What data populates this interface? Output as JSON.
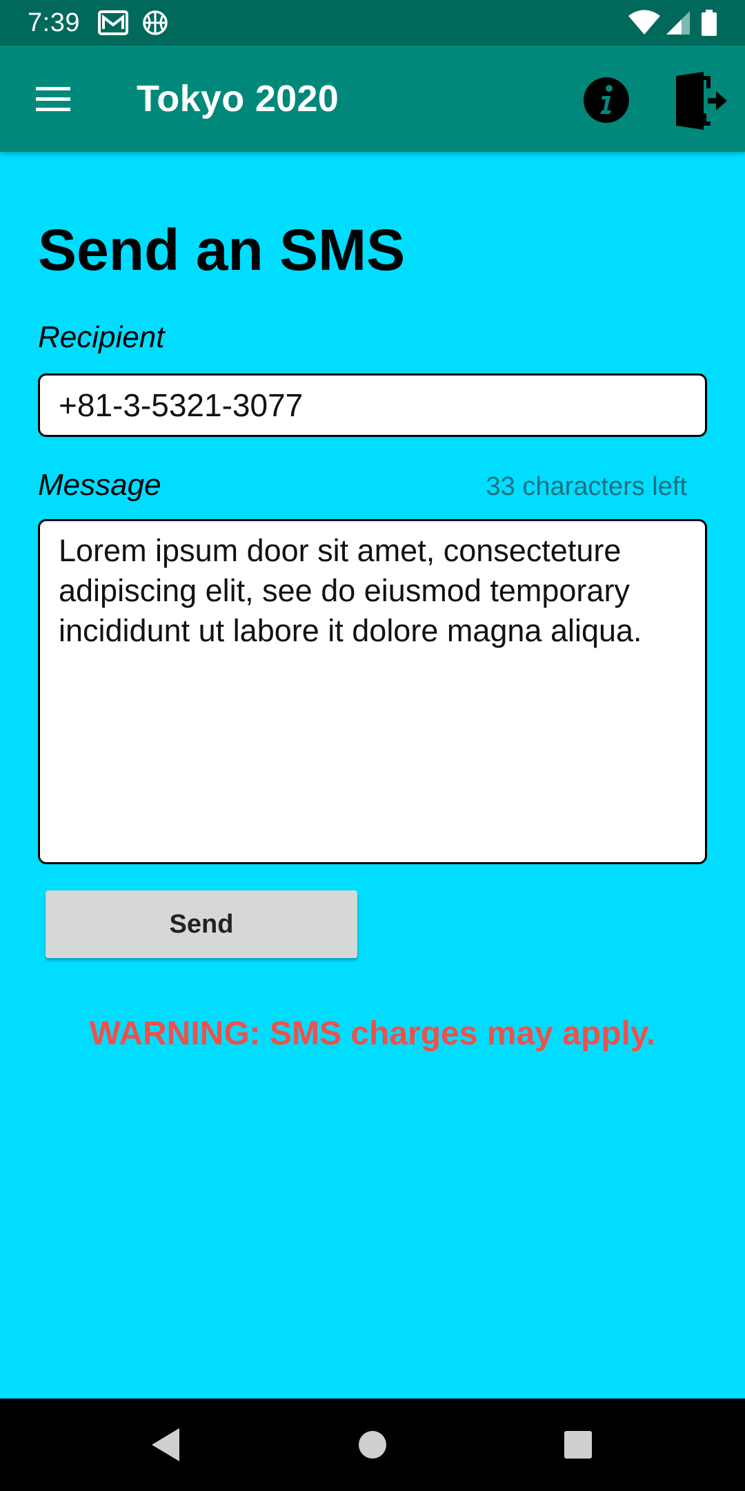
{
  "status_bar": {
    "time": "7:39",
    "icons": [
      "gmail-icon",
      "basketball-icon",
      "wifi-icon",
      "cell-signal-icon",
      "battery-icon"
    ]
  },
  "app_bar": {
    "title": "Tokyo 2020",
    "menu_icon": "hamburger-menu-icon",
    "info_icon": "info-icon",
    "exit_icon": "exit-door-icon",
    "background": "#00897B",
    "status_background": "#00695C"
  },
  "form": {
    "page_title": "Send an SMS",
    "recipient_label": "Recipient",
    "recipient_value": "+81-3-5321-3077",
    "message_label": "Message",
    "chars_left": "33 characters left",
    "message_value": "Lorem ipsum door sit amet, consecteture adipiscing elit, see do eiusmod temporary incididunt ut labore it dolore magna aliqua.",
    "send_label": "Send",
    "warning": "WARNING: SMS charges may apply."
  },
  "nav_bar": {
    "icons": [
      "back-icon",
      "home-icon",
      "recents-icon"
    ]
  },
  "colors": {
    "page_background": "#00DDFF",
    "warning": "#F0504A",
    "button": "#D6D7D7"
  }
}
